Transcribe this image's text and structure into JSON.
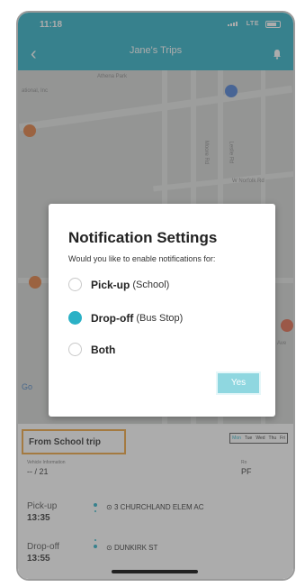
{
  "status_bar": {
    "time": "11:18",
    "network": "LTE"
  },
  "header": {
    "title": "Jane's Trips"
  },
  "map": {
    "labels": [
      "ational, Inc",
      "Athena Park",
      "W Norfolk Rd",
      "Moore Rd",
      "Leslie Rd",
      "Ave",
      "Go"
    ]
  },
  "dialog": {
    "title": "Notification Settings",
    "question": "Would you like to enable notifications for:",
    "options": [
      {
        "label": "Pick-up",
        "sub": "(School)",
        "checked": false
      },
      {
        "label": "Drop-off",
        "sub": "(Bus Stop)",
        "checked": true
      },
      {
        "label": "Both",
        "sub": "",
        "checked": false
      }
    ],
    "yes_label": "Yes"
  },
  "trip": {
    "title": "From School trip",
    "days": [
      "Mon",
      "Tue",
      "Wed",
      "Thu",
      "Fri"
    ],
    "vehicle_label": "Vehicle Information",
    "vehicle_value": "-- / 21",
    "right_label": "Ro",
    "right_value": "PF",
    "pickup": {
      "label": "Pick-up",
      "time": "13:35",
      "stop": "3 CHURCHLAND ELEM AC"
    },
    "dropoff": {
      "label": "Drop-off",
      "time": "13:55",
      "stop": "DUNKIRK ST"
    }
  },
  "colors": {
    "accent": "#2bb1c6",
    "highlight": "#f0a43c"
  }
}
